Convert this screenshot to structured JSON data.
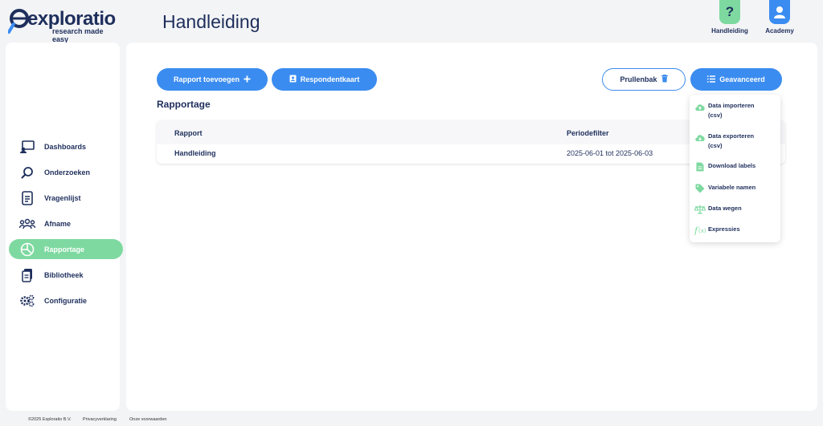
{
  "app": {
    "logo_word": "exploratio",
    "logo_tagline": "research made easy",
    "page_title": "Handleiding"
  },
  "header_buttons": [
    {
      "label": "Handleiding",
      "glyph": "?",
      "icon": "question-icon",
      "color": "#7ed9a0"
    },
    {
      "label": "Academy",
      "icon": "user-icon",
      "color": "#3b8cf0"
    }
  ],
  "sidebar": {
    "items": [
      {
        "label": "Dashboards",
        "icon": "dashboard-icon",
        "active": false
      },
      {
        "label": "Onderzoeken",
        "icon": "search-icon",
        "active": false
      },
      {
        "label": "Vragenlijst",
        "icon": "document-icon",
        "active": false
      },
      {
        "label": "Afname",
        "icon": "group-icon",
        "active": false
      },
      {
        "label": "Rapportage",
        "icon": "pie-chart-icon",
        "active": true
      },
      {
        "label": "Bibliotheek",
        "icon": "library-icon",
        "active": false
      },
      {
        "label": "Configuratie",
        "icon": "gears-icon",
        "active": false
      }
    ]
  },
  "toolbar": {
    "add_report_label": "Rapport toevoegen",
    "respondent_card_label": "Respondentkaart",
    "trash_label": "Prullenbak",
    "advanced_label": "Geavanceerd"
  },
  "section": {
    "title": "Rapportage"
  },
  "table": {
    "columns": [
      "Rapport",
      "Periodefilter"
    ],
    "rows": [
      {
        "rapport": "Handleiding",
        "periode": "2025-06-01 tot 2025-06-03"
      }
    ]
  },
  "dropdown": {
    "items": [
      {
        "line1": "Data importeren",
        "line2": "(csv)",
        "icon": "cloud-upload-icon"
      },
      {
        "line1": "Data exporteren",
        "line2": "(csv)",
        "icon": "cloud-download-icon"
      },
      {
        "line1": "Download labels",
        "icon": "file-icon"
      },
      {
        "line1": "Variabele namen",
        "icon": "tag-icon"
      },
      {
        "line1": "Data wegen",
        "icon": "scale-icon"
      },
      {
        "line1": "Expressies",
        "icon": "function-icon"
      }
    ]
  },
  "footer": {
    "copyright": "©2025 Exploratio B.V.",
    "privacy": "Privacyverklaring",
    "terms": "Onze voorwaarden"
  },
  "colors": {
    "primary_blue": "#3b8cf0",
    "accent_green": "#7ed9a0",
    "navy": "#1e2f5c"
  }
}
